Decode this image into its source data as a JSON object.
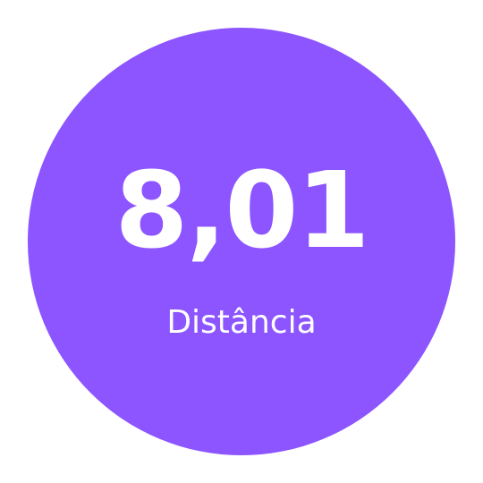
{
  "metric": {
    "value": "8,01",
    "label": "Distância",
    "circle_color": "#8c55ff",
    "text_color": "#ffffff"
  }
}
